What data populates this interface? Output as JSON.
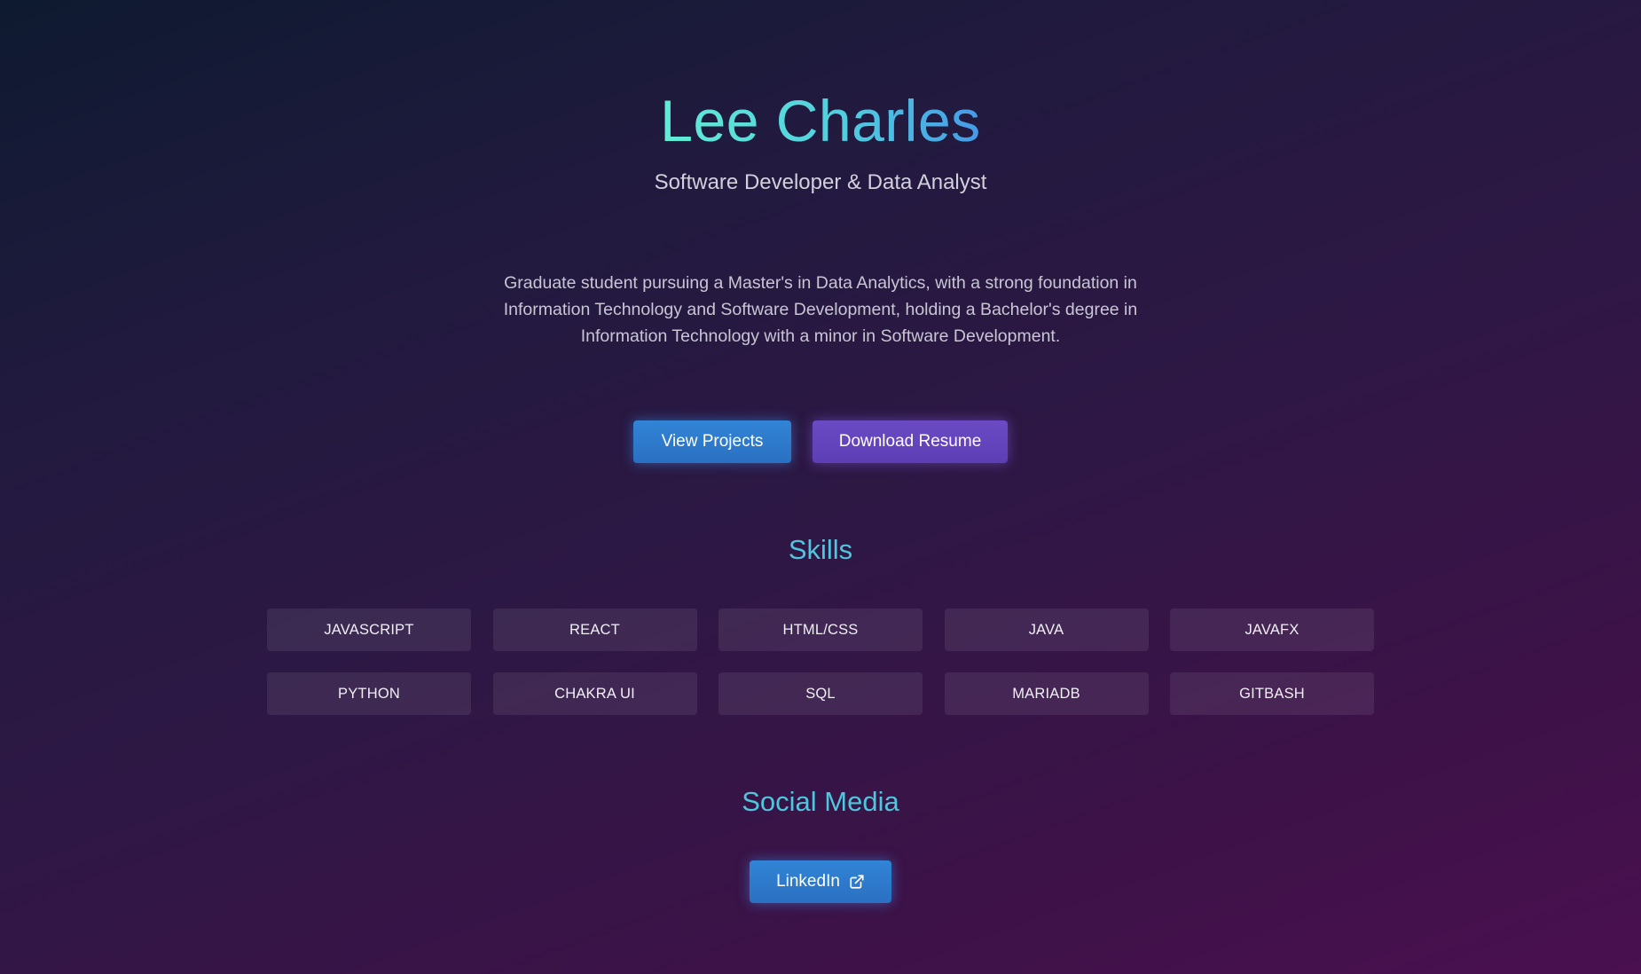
{
  "hero": {
    "name": "Lee Charles",
    "subtitle": "Software Developer & Data Analyst",
    "bio": "Graduate student pursuing a Master's in Data Analytics, with a strong foundation in Information Technology and Software Development, holding a Bachelor's degree in Information Technology with a minor in Software Development."
  },
  "actions": {
    "view_projects": "View Projects",
    "download_resume": "Download Resume"
  },
  "skills": {
    "heading": "Skills",
    "items": [
      "JAVASCRIPT",
      "REACT",
      "HTML/CSS",
      "JAVA",
      "JAVAFX",
      "PYTHON",
      "CHAKRA UI",
      "SQL",
      "MARIADB",
      "GITBASH"
    ]
  },
  "social": {
    "heading": "Social Media",
    "linkedin_label": "LinkedIn",
    "linkedin_icon": "external-link-icon"
  },
  "colors": {
    "accent_teal": "#4fc6dc",
    "button_blue": "#2f7dd0",
    "button_purple": "#6646bd"
  }
}
